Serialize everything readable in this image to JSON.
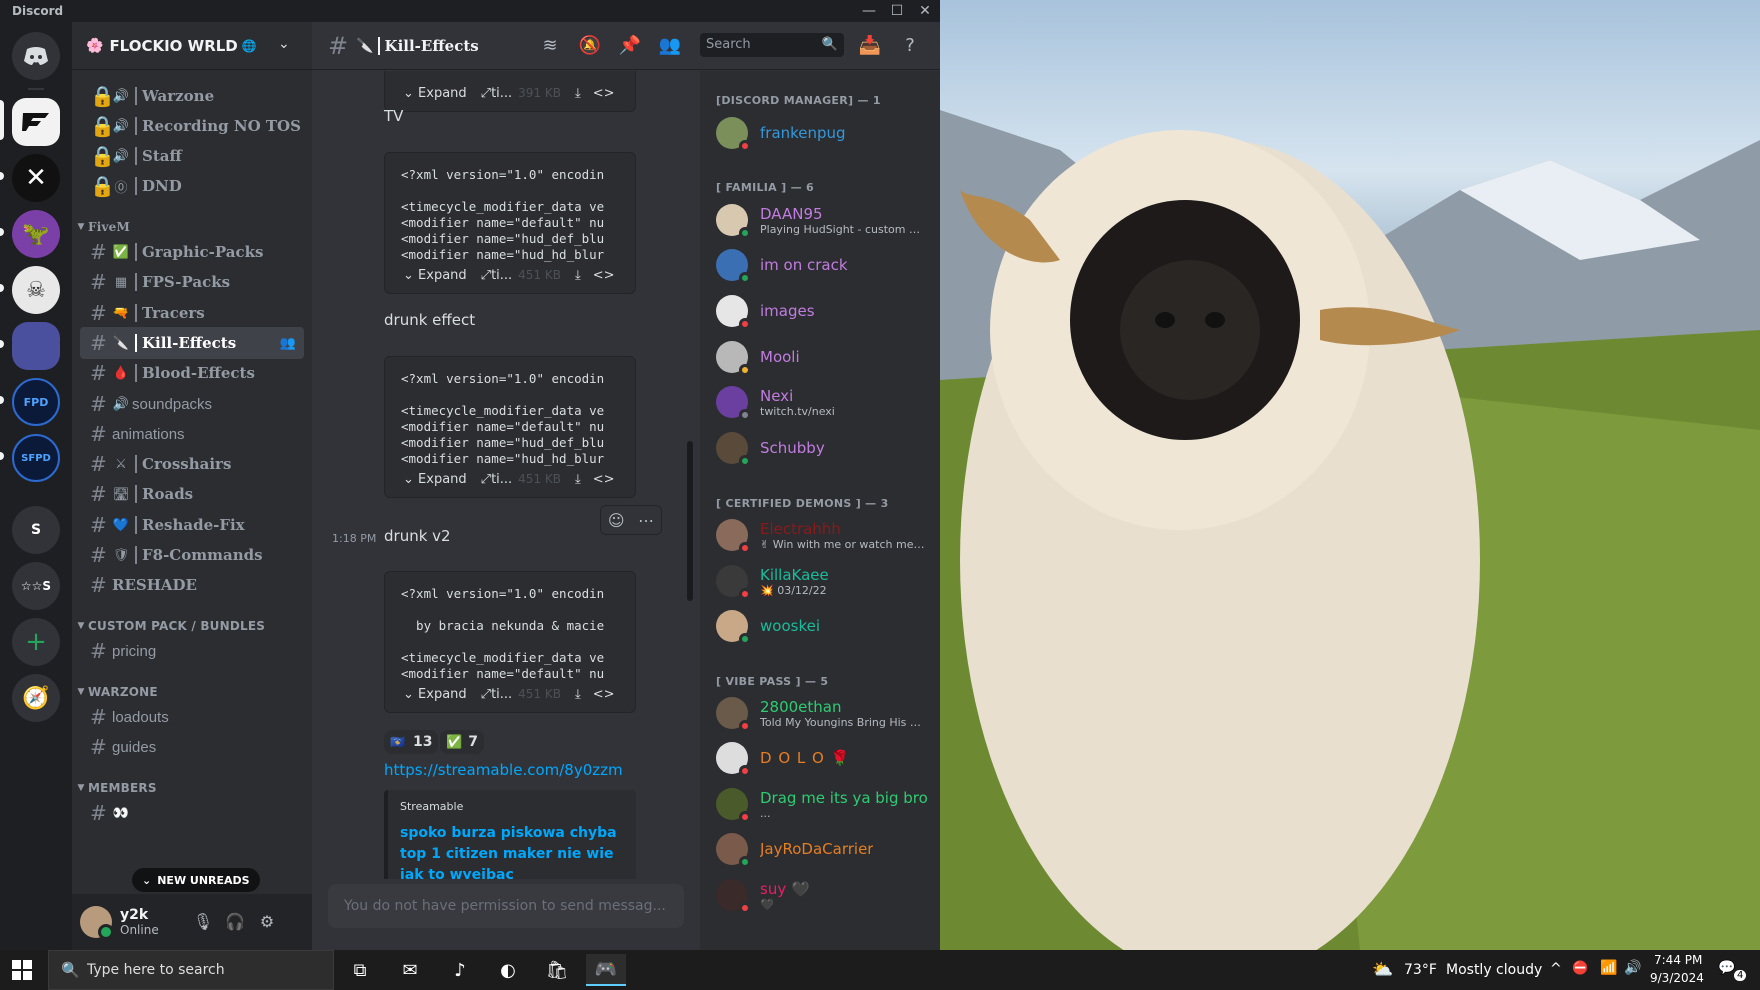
{
  "window": {
    "app_name": "Discord"
  },
  "server": {
    "name": "FLOCKIO WRLD"
  },
  "servers": [
    {
      "name": "home",
      "label": ""
    },
    {
      "name": "active-server",
      "label": ""
    },
    {
      "name": "server-x",
      "label": ""
    },
    {
      "name": "server-purple",
      "label": ""
    },
    {
      "name": "server-white",
      "label": ""
    },
    {
      "name": "server-blue",
      "label": ""
    },
    {
      "name": "server-fpd",
      "label": ""
    },
    {
      "name": "server-sfpd",
      "label": ""
    },
    {
      "name": "server-s",
      "label": "S"
    },
    {
      "name": "server-stars",
      "label": "☆☆S"
    }
  ],
  "channels_top": [
    {
      "icon": "🔊",
      "label": "Warzone",
      "locked": true
    },
    {
      "icon": "🔊",
      "label": "Recording NO TOS",
      "locked": true
    },
    {
      "icon": "🔊",
      "label": "Staff",
      "locked": true
    },
    {
      "icon": "⓪",
      "label": "DND",
      "locked": true
    }
  ],
  "categories": {
    "fivem": "FiveM",
    "custom": "CUSTOM PACK / BUNDLES",
    "warzone": "WARZONE",
    "members": "MEMBERS"
  },
  "channels_fivem": [
    {
      "icon": "✅",
      "label": "Graphic-Packs"
    },
    {
      "icon": "▦",
      "label": "FPS-Packs"
    },
    {
      "icon": "🔫",
      "label": "Tracers"
    },
    {
      "icon": "🔪",
      "label": "Kill-Effects"
    },
    {
      "icon": "🩸",
      "label": "Blood-Effects"
    },
    {
      "icon": "🔊",
      "label": "soundpacks"
    },
    {
      "icon": "",
      "label": "animations"
    },
    {
      "icon": "⚔",
      "label": "Crosshairs"
    },
    {
      "icon": "🛣",
      "label": "Roads"
    },
    {
      "icon": "💙",
      "label": "Reshade-Fix"
    },
    {
      "icon": "🛡",
      "label": "F8-Commands"
    },
    {
      "icon": "",
      "label": "RESHADE"
    }
  ],
  "channels_custom": [
    {
      "label": "pricing"
    }
  ],
  "channels_warzone": [
    {
      "label": "loadouts"
    },
    {
      "label": "guides"
    }
  ],
  "new_unreads": "NEW UNREADS",
  "user": {
    "name": "y2k",
    "status": "Online"
  },
  "chat": {
    "channel_title": "Kill-Effects",
    "search_placeholder": "Search",
    "composer_placeholder": "You do not have permission to send messag...",
    "expand_label": "Expand",
    "file_short": "ti...",
    "sizes": [
      "391 KB",
      "451 KB",
      "451 KB",
      "451 KB"
    ],
    "captions": [
      "TV",
      "drunk effect",
      "drunk v2"
    ],
    "time": "1:18 PM",
    "code_blocks": [
      "<?xml version=\"1.0\" encodin\n\n<timecycle_modifier_data ve\n<modifier name=\"default\" nu\n<modifier name=\"hud_def_blu\n<modifier name=\"hud_hd_blur",
      "<?xml version=\"1.0\" encodin\n\n<timecycle_modifier_data ve\n<modifier name=\"default\" nu\n<modifier name=\"hud_def_blu\n<modifier name=\"hud_hd_blur",
      "<?xml version=\"1.0\" encodin\n\n  by bracia nekunda & macie\n\n<timecycle_modifier_data ve\n<modifier name=\"default\" nu"
    ],
    "reactions": [
      {
        "emoji": "🇽🇰",
        "count": "13"
      },
      {
        "emoji": "✅",
        "count": "7"
      }
    ],
    "link": "https://streamable.com/8y0zzm",
    "embed": {
      "provider": "Streamable",
      "title": "spoko burza piskowa chyba top 1 citizen maker nie wie jak to wyeibac"
    }
  },
  "member_groups": [
    {
      "label": "[DISCORD MANAGER] — 1"
    },
    {
      "label": "[ FAMILIA ] — 6"
    },
    {
      "label": "[ CERTIFIED DEMONS ] — 3"
    },
    {
      "label": "[ VIBE PASS ] — 5"
    }
  ],
  "members": [
    {
      "name": "frankenpug",
      "sub": "",
      "color": "#3498db",
      "status": "#f23f43",
      "avatar": "#7a8f5a"
    },
    {
      "name": "DAAN95",
      "sub": "Playing HudSight - custom cr...",
      "color": "#c27ce0",
      "status": "#23a55a",
      "avatar": "#d8c8b0"
    },
    {
      "name": "im on crack",
      "sub": "",
      "color": "#c27ce0",
      "status": "#23a55a",
      "avatar": "#3b6fb3"
    },
    {
      "name": "images",
      "sub": "",
      "color": "#c27ce0",
      "status": "#f23f43",
      "avatar": "#e6e6e6"
    },
    {
      "name": "Mooli",
      "sub": "",
      "color": "#c27ce0",
      "status": "#f0b232",
      "avatar": "#b8b8b8"
    },
    {
      "name": "Nexi",
      "sub": "twitch.tv/nexi",
      "color": "#c27ce0",
      "status": "#80848e",
      "avatar": "#6b3fa0"
    },
    {
      "name": "Schubby",
      "sub": "",
      "color": "#c27ce0",
      "status": "#23a55a",
      "avatar": "#5a4a3a"
    },
    {
      "name": "Electrahhh",
      "sub": "✌ Win with me or watch me ...",
      "color": "#8b1a1a",
      "status": "#f23f43",
      "avatar": "#8a6a5a"
    },
    {
      "name": "KillaKaee",
      "sub": "💥 03/12/22",
      "color": "#1abc9c",
      "status": "#f23f43",
      "avatar": "#3a3a3a"
    },
    {
      "name": "wooskei",
      "sub": "",
      "color": "#1abc9c",
      "status": "#23a55a",
      "avatar": "#c9a888"
    },
    {
      "name": "2800ethan",
      "sub": "Told My Youngins Bring His He...",
      "color": "#2ecc71",
      "status": "#f23f43",
      "avatar": "#6a5a4a"
    },
    {
      "name": "D O L O 🌹",
      "sub": "",
      "color": "#e67e22",
      "status": "#f23f43",
      "avatar": "#dddddd"
    },
    {
      "name": "Drag me its ya big bro",
      "sub": "...",
      "color": "#2ecc71",
      "status": "#f23f43",
      "avatar": "#4a5a2a"
    },
    {
      "name": "JayRoDaCarrier",
      "sub": "",
      "color": "#e67e22",
      "status": "#23a55a",
      "avatar": "#7a5a4a"
    },
    {
      "name": "suy 🖤",
      "sub": "🖤",
      "color": "#e91e63",
      "status": "#f23f43",
      "avatar": "#3a2a2a"
    }
  ],
  "taskbar": {
    "search_placeholder": "Type here to search",
    "weather_temp": "73°F",
    "weather_text": "Mostly cloudy",
    "time": "7:44 PM",
    "date": "9/3/2024",
    "notification_count": "4"
  }
}
